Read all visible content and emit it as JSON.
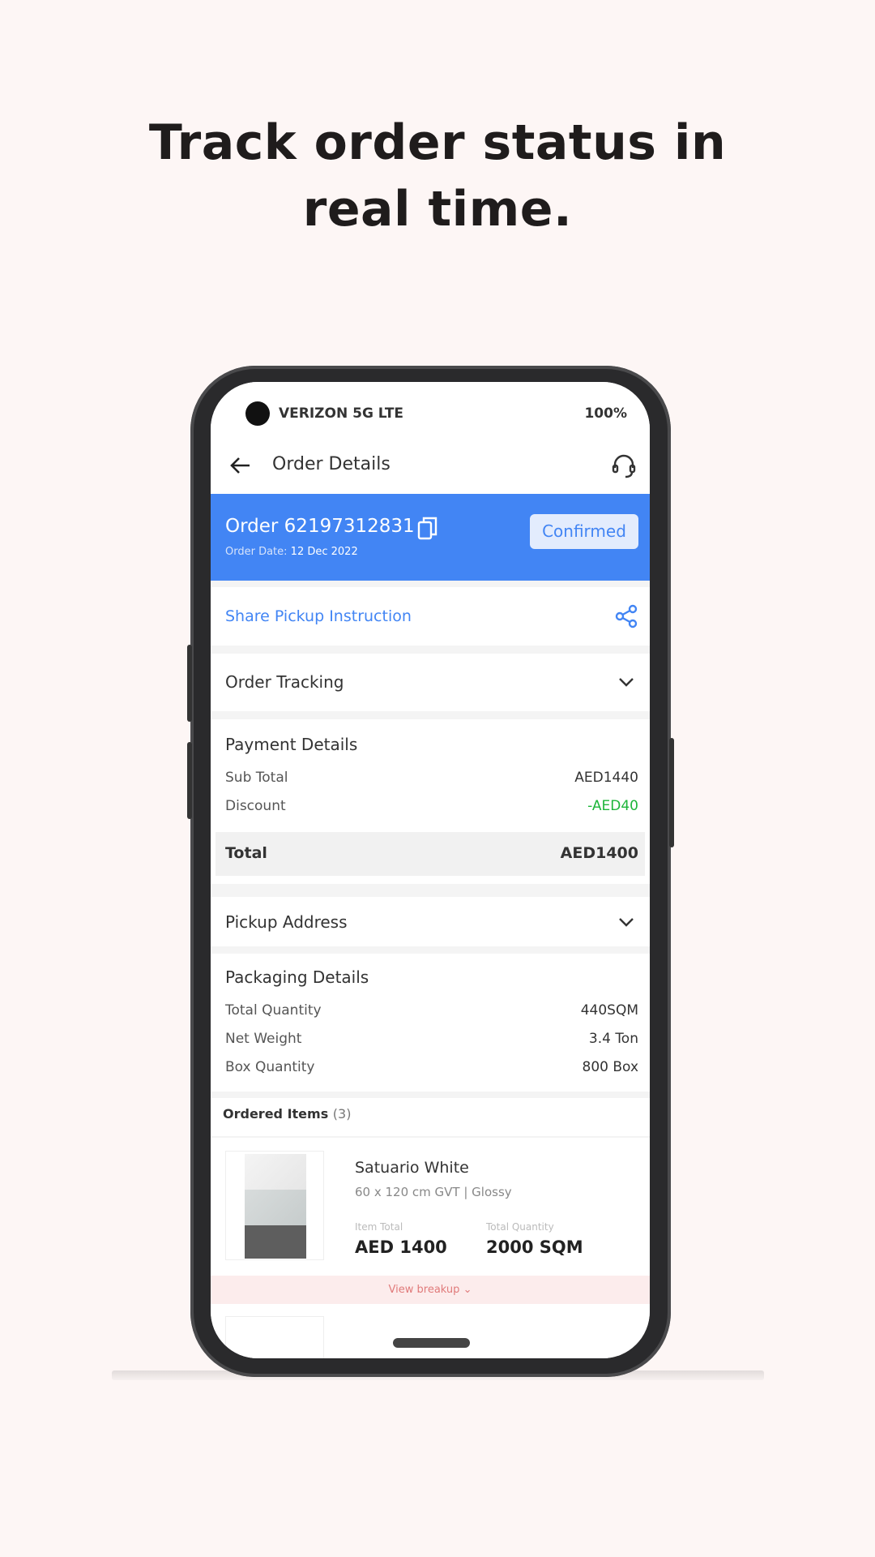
{
  "headline": {
    "line1": "Track order status in",
    "line2": "real time."
  },
  "status_bar": {
    "carrier": "VERIZON 5G LTE",
    "battery": "100%"
  },
  "header": {
    "title": "Order Details",
    "back_icon": "arrow-left-icon",
    "support_icon": "headset-icon"
  },
  "order": {
    "number": "Order 62197312831",
    "date_label": "Order Date:",
    "date_value": "12 Dec 2022",
    "status": "Confirmed",
    "accent": "#4285f4"
  },
  "share": {
    "label": "Share Pickup Instruction",
    "icon": "share-icon"
  },
  "tracking": {
    "label": "Order Tracking"
  },
  "payment": {
    "title": "Payment Details",
    "rows": [
      {
        "label": "Sub Total",
        "value": "AED1440"
      },
      {
        "label": "Discount",
        "value": "-AED40"
      }
    ],
    "total_label": "Total",
    "total_value": "AED1400",
    "discount_color": "#1db53a"
  },
  "pickup": {
    "label": "Pickup Address"
  },
  "packaging": {
    "title": "Packaging Details",
    "rows": [
      {
        "label": "Total Quantity",
        "value": "440SQM"
      },
      {
        "label": "Net Weight",
        "value": "3.4 Ton"
      },
      {
        "label": "Box Quantity",
        "value": "800 Box"
      }
    ]
  },
  "ordered_items": {
    "title": "Ordered Items",
    "count": "(3)",
    "items": [
      {
        "name": "Satuario White",
        "spec": "60 x 120 cm GVT | Glossy",
        "total_label": "Item Total",
        "total_value": "AED 1400",
        "qty_label": "Total Quantity",
        "qty_value": "2000 SQM"
      }
    ],
    "view_breakup": "View breakup"
  }
}
